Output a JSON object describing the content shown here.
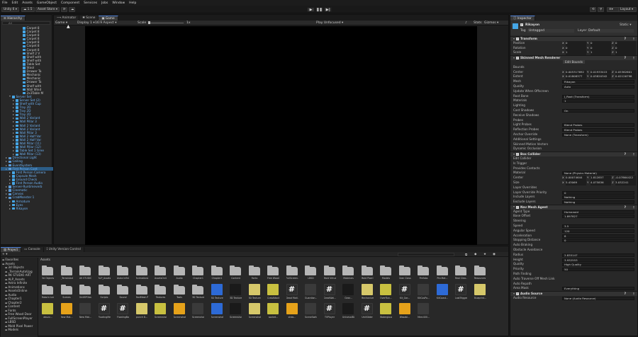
{
  "menu": [
    "File",
    "Edit",
    "Assets",
    "GameObject",
    "Component",
    "Services",
    "Jobs",
    "Window",
    "Help"
  ],
  "toolbar": {
    "account": "Unity 6",
    "cloud": "1.5",
    "asset_store": "Asset Store",
    "layout": "Layout"
  },
  "hierarchy": {
    "tab": "Hierarchy",
    "search_placeholder": "All",
    "rows": [
      {
        "t": "Carpet 8",
        "i": 5
      },
      {
        "t": "Carpet 8",
        "i": 5
      },
      {
        "t": "Carpet 8",
        "i": 5
      },
      {
        "t": "Carpet 8",
        "i": 5
      },
      {
        "t": "Carpet 8",
        "i": 5
      },
      {
        "t": "Carpet 8",
        "i": 5
      },
      {
        "t": "Carpet 8",
        "i": 5
      },
      {
        "t": "Shelf 2 V",
        "i": 5
      },
      {
        "t": "Shelf with",
        "i": 5
      },
      {
        "t": "Shelf with",
        "i": 5
      },
      {
        "t": "Table Set",
        "i": 5
      },
      {
        "t": "Stool",
        "i": 5
      },
      {
        "t": "Drawer Ta",
        "i": 5
      },
      {
        "t": "Mechanic",
        "i": 5
      },
      {
        "t": "Mechanic",
        "i": 5
      },
      {
        "t": "Drawer Ta",
        "i": 5
      },
      {
        "t": "Shelf with",
        "i": 5
      },
      {
        "t": "Wall Wind",
        "i": 5
      },
      {
        "t": "2x3Table M",
        "i": 5
      },
      {
        "t": "Server Set",
        "i": 2,
        "caret": true
      },
      {
        "t": "Server Set (2)",
        "i": 3
      },
      {
        "t": "Shelf with Cup",
        "i": 3
      },
      {
        "t": "Tray 2D",
        "i": 3
      },
      {
        "t": "Tray 2D",
        "i": 3
      },
      {
        "t": "Tray 2D",
        "i": 3
      },
      {
        "t": "Wall 2 Variant",
        "i": 3
      },
      {
        "t": "Wall Pillar 3",
        "i": 3
      },
      {
        "t": "Wall 2 Variant",
        "i": 3
      },
      {
        "t": "Wall 2 Variant",
        "i": 3
      },
      {
        "t": "Wall Pillar 3",
        "i": 3
      },
      {
        "t": "Wall 2 Half Var",
        "i": 3
      },
      {
        "t": "Wall 2 Half Var",
        "i": 3
      },
      {
        "t": "Wall Pillar (11)",
        "i": 3
      },
      {
        "t": "Wall Pillar (12)",
        "i": 3
      },
      {
        "t": "Table Set 1 Gree",
        "i": 3
      },
      {
        "t": "Wall Pillar (13)",
        "i": 3
      },
      {
        "t": "Directional Light",
        "i": 1
      },
      {
        "t": "Ceiling",
        "i": 1
      },
      {
        "t": "EventSystem",
        "i": 1
      },
      {
        "t": "First Person Cont",
        "i": 1,
        "sel": true
      },
      {
        "t": "First Person Camera",
        "i": 2
      },
      {
        "t": "Capsule Mesh",
        "i": 2
      },
      {
        "t": "Ground Check",
        "i": 2
      },
      {
        "t": "First Person Audio",
        "i": 2
      },
      {
        "t": "Server-Runtimeverb",
        "i": 1
      },
      {
        "t": "Cinematic",
        "i": 1
      },
      {
        "t": "Canvas",
        "i": 1
      },
      {
        "t": "CrabMonster 1",
        "i": 1
      },
      {
        "t": "Armature",
        "i": 2
      },
      {
        "t": "Eyes",
        "i": 2
      },
      {
        "t": "Rikayon",
        "i": 2
      }
    ]
  },
  "game": {
    "tabs": [
      "Animator",
      "Scene",
      "Game"
    ],
    "display": "Game",
    "display_num": "Display 1",
    "aspect": "16:9 Aspect",
    "scale_label": "Scale",
    "scale_value": "1x",
    "play_mode": "Play Unfocused",
    "stats": "Stats",
    "gizmos": "Gizmos"
  },
  "inspector": {
    "tab": "Inspector",
    "name": "Rikayon",
    "static": "Static",
    "tag_label": "Tag",
    "tag": "Untagged",
    "layer_label": "Layer",
    "layer": "Default",
    "transform": {
      "title": "Transform",
      "rows": [
        {
          "label": "Position",
          "x": "0",
          "y": "0",
          "z": "0"
        },
        {
          "label": "Rotation",
          "x": "0",
          "y": "0",
          "z": "0"
        },
        {
          "label": "Scale",
          "x": "1",
          "y": "1",
          "z": "1"
        }
      ]
    },
    "skinned": {
      "title": "Skinned Mesh Renderer",
      "edit_bounds": "Edit Bounds",
      "bounds_label": "Bounds",
      "center_label": "Center",
      "center": {
        "x": "0.005317692",
        "y": "0.01933415",
        "z": "0.05362601"
      },
      "extent_label": "Extent",
      "extent": {
        "x": "0.01808377",
        "y": "0.03820342",
        "z": "0.02126798"
      },
      "rows": [
        {
          "l": "Mesh",
          "v": "Rikayon"
        },
        {
          "l": "Quality",
          "v": "Auto"
        },
        {
          "l": "Update When Offscreen",
          "v": ""
        },
        {
          "l": "Root Bone",
          "v": "J_Root (Transform)"
        },
        {
          "l": "Materials",
          "v": "1"
        },
        {
          "l": "Lighting",
          "v": ""
        },
        {
          "l": "Cast Shadows",
          "v": "On"
        },
        {
          "l": "Receive Shadows",
          "v": ""
        },
        {
          "l": "Probes",
          "v": ""
        },
        {
          "l": "Light Probes",
          "v": "Blend Probes"
        },
        {
          "l": "Reflection Probes",
          "v": "Blend Probes"
        },
        {
          "l": "Anchor Override",
          "v": "None (Transform)"
        },
        {
          "l": "Additional Settings",
          "v": ""
        },
        {
          "l": "Skinned Motion Vectors",
          "v": ""
        },
        {
          "l": "Dynamic Occlusion",
          "v": ""
        }
      ]
    },
    "box": {
      "title": "Box Collider",
      "rows": [
        {
          "l": "Edit Collider",
          "v": ""
        },
        {
          "l": "Is Trigger",
          "v": ""
        },
        {
          "l": "Provides Contacts",
          "v": ""
        },
        {
          "l": "Material",
          "v": "None (Physics Material)"
        },
        {
          "l": "Center",
          "x": "0.00074644",
          "y": "1.812857",
          "z": "-0.07864422"
        },
        {
          "l": "Size",
          "x": "5.43069",
          "y": "4.075836",
          "z": "3.032241"
        },
        {
          "l": "Layer Overrides",
          "v": ""
        },
        {
          "l": "Layer Override Priority",
          "v": "0"
        },
        {
          "l": "Include Layers",
          "v": "Nothing"
        },
        {
          "l": "Exclude Layers",
          "v": "Nothing"
        }
      ]
    },
    "nav": {
      "title": "Nav Mesh Agent",
      "rows": [
        {
          "l": "Agent Type",
          "v": "Humanoid"
        },
        {
          "l": "Base Offset",
          "v": "1.897827"
        },
        {
          "l": "Steering",
          "v": ""
        },
        {
          "l": "Speed",
          "v": "3.5"
        },
        {
          "l": "Angular Speed",
          "v": "120"
        },
        {
          "l": "Acceleration",
          "v": "8"
        },
        {
          "l": "Stopping Distance",
          "v": "0"
        },
        {
          "l": "Auto Braking",
          "v": ""
        },
        {
          "l": "Obstacle Avoidance",
          "v": ""
        },
        {
          "l": "Radius",
          "v": "2.835147"
        },
        {
          "l": "Height",
          "v": "3.932553"
        },
        {
          "l": "Quality",
          "v": "High Quality"
        },
        {
          "l": "Priority",
          "v": "50"
        },
        {
          "l": "Path Finding",
          "v": ""
        },
        {
          "l": "Auto Traverse Off Mesh Link",
          "v": ""
        },
        {
          "l": "Auto Repath",
          "v": ""
        },
        {
          "l": "Area Mask",
          "v": "Everything"
        }
      ]
    },
    "audio": {
      "title": "Audio Source",
      "first_label": "Audio Resource",
      "first_value": "None (Audio Resource)"
    }
  },
  "project": {
    "tabs": [
      "Project",
      "Console",
      "Unity Version Control"
    ],
    "breadcrumb": "Assets",
    "tree": [
      {
        "t": "Favorites",
        "i": 0
      },
      {
        "t": "Assets",
        "i": 0
      },
      {
        "t": "3d Objects",
        "i": 1
      },
      {
        "t": "_TerrainAutoUpg",
        "i": 1
      },
      {
        "t": "AK STUDIO ART",
        "i": 1
      },
      {
        "t": "ALP_Assets",
        "i": 1
      },
      {
        "t": "Astra Infinite",
        "i": 1
      },
      {
        "t": "Animations",
        "i": 1
      },
      {
        "t": "AssetsOnline",
        "i": 1
      },
      {
        "t": "Audio",
        "i": 1
      },
      {
        "t": "Chapter1",
        "i": 1
      },
      {
        "t": "Chapter2",
        "i": 1
      },
      {
        "t": "Content",
        "i": 1
      },
      {
        "t": "Fonts",
        "i": 1
      },
      {
        "t": "Free Wood Door",
        "i": 1
      },
      {
        "t": "FullScreenPlayer",
        "i": 1
      },
      {
        "t": "LBSD",
        "i": 1
      },
      {
        "t": "Mold Pixel Power",
        "i": 1
      },
      {
        "t": "Models",
        "i": 1
      }
    ],
    "row1": [
      "3d Objects",
      "_TerrainAuto...",
      "AK STUDIO...",
      "ALP_Assets",
      "Astra Infinite",
      "Animations",
      "AssetsOnline",
      "Audio",
      "Chapter1",
      "Chapter1",
      "Content",
      "Fonts",
      "Free Wood...",
      "FullScreen...",
      "LBSD",
      "Mold Virtual...",
      "Materials",
      "Mold Pixel P...",
      "Models",
      "Gran Class...",
      "Prefabs",
      "Pro Mat...",
      "Real Cleo...",
      "Resources"
    ],
    "row2": [
      "Robo's turr...",
      "Scenes",
      "SkillSPObst...",
      "Scripts",
      "Sound",
      "TextMesh P...",
      "Textures",
      "Tools",
      "3D Texture",
      "3D Texture",
      "3D Texture",
      "3D Texture",
      "CrabAttack",
      "Dead Moti...",
      "Guardian...",
      "GreatWal...",
      "Gear...",
      "Mechanium...",
      "OverRun...",
      "Kit_Gar...",
      "KitCosPo...",
      "KitCoast...",
      "LastTrigger",
      "Blueprint..."
    ],
    "row3": [
      "abuzz...",
      "New Mat...",
      "New Mat...",
      "FloatingMe...",
      "FloatingBa...",
      "punch 8...",
      "Screenshot...",
      "Screenshot...",
      "Screenshot...",
      "Screenshot...",
      "Screenshot...",
      "Screenshot...",
      "socket...",
      "shdo...",
      "SceneSwitch",
      "TVPlayer",
      "UnivesalBla...",
      "UnitSlider",
      "Watergloss...",
      "Wasabi...",
      "Merc400..."
    ]
  }
}
